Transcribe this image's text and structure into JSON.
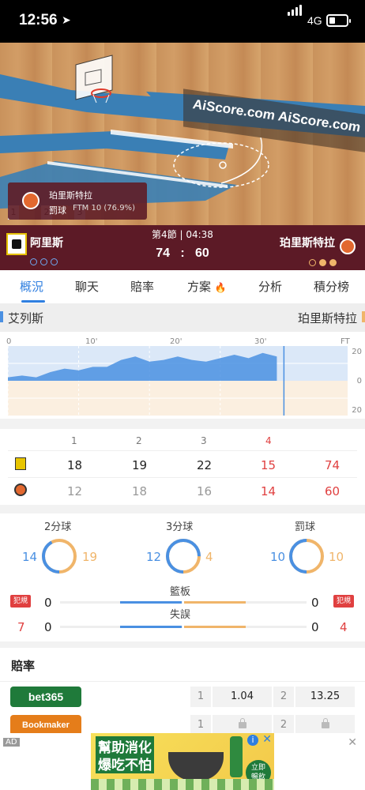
{
  "status_bar": {
    "time": "12:56",
    "network": "4G"
  },
  "watermark": "AiScore.com AiScore.com",
  "periods": [
    "1",
    "2",
    "3"
  ],
  "event": {
    "team": "珀里斯特拉",
    "action": "罰球",
    "detail": "FTM 10 (76.9%)"
  },
  "scoreboard": {
    "clock": "第4節 | 04:38",
    "home_team": "阿里斯",
    "away_team": "珀里斯特拉",
    "home_score": "74",
    "separator": ":",
    "away_score": "60"
  },
  "tabs": [
    {
      "label": "概況",
      "active": true
    },
    {
      "label": "聊天"
    },
    {
      "label": "賠率"
    },
    {
      "label": "方案"
    },
    {
      "label": "分析"
    },
    {
      "label": "積分榜"
    }
  ],
  "team_names": {
    "left": "艾列斯",
    "right": "珀里斯特拉"
  },
  "trend": {
    "x_ticks": [
      "0",
      "10'",
      "20'",
      "30'",
      "FT"
    ],
    "y_ticks": [
      "20",
      "0",
      "20"
    ]
  },
  "chart_data": {
    "type": "area",
    "x": [
      0,
      2,
      4,
      6,
      8,
      10,
      12,
      14,
      16,
      18,
      20,
      22,
      24,
      26,
      28,
      30,
      32,
      34,
      36,
      38
    ],
    "series": [
      {
        "values": [
          2,
          3,
          2,
          5,
          7,
          6,
          8,
          8,
          12,
          14,
          11,
          12,
          14,
          12,
          11,
          13,
          15,
          13,
          16,
          14
        ]
      }
    ],
    "ylim": [
      -20,
      20
    ],
    "grid": true,
    "colors": {
      "home": "#4a90e2",
      "away": "#f0b56a"
    }
  },
  "quarters": {
    "headers": [
      "1",
      "2",
      "3",
      "4"
    ],
    "home": [
      "18",
      "19",
      "22",
      "15",
      "74"
    ],
    "away": [
      "12",
      "18",
      "16",
      "14",
      "60"
    ]
  },
  "stats": {
    "two_pt": {
      "label": "2分球",
      "home": "14",
      "away": "19",
      "home_share": 0.42
    },
    "three_pt": {
      "label": "3分球",
      "home": "12",
      "away": "4",
      "home_share": 0.75
    },
    "free_throw": {
      "label": "罰球",
      "home": "10",
      "away": "10",
      "home_share": 0.5
    },
    "foul_label": "犯規",
    "home_fouls": "7",
    "away_fouls": "4",
    "rebounds": {
      "label": "籃板",
      "home": "0",
      "away": "0"
    },
    "turnovers": {
      "label": "失誤",
      "home": "0",
      "away": "0"
    }
  },
  "odds": {
    "title": "賠率",
    "bookmakers": [
      {
        "name": "bet365",
        "col1": "1",
        "val1": "1.04",
        "col2": "2",
        "val2": "13.25",
        "color": "#1f7a3a"
      },
      {
        "name": "Bookmaker",
        "col1": "1",
        "col2": "2",
        "locked": true,
        "color": "#e57d1a"
      }
    ]
  },
  "ad": {
    "tag": "AD",
    "line1": "幫助消化",
    "line2": "爆吃不怕",
    "cta_line1": "立即",
    "cta_line2": "暢飲"
  }
}
